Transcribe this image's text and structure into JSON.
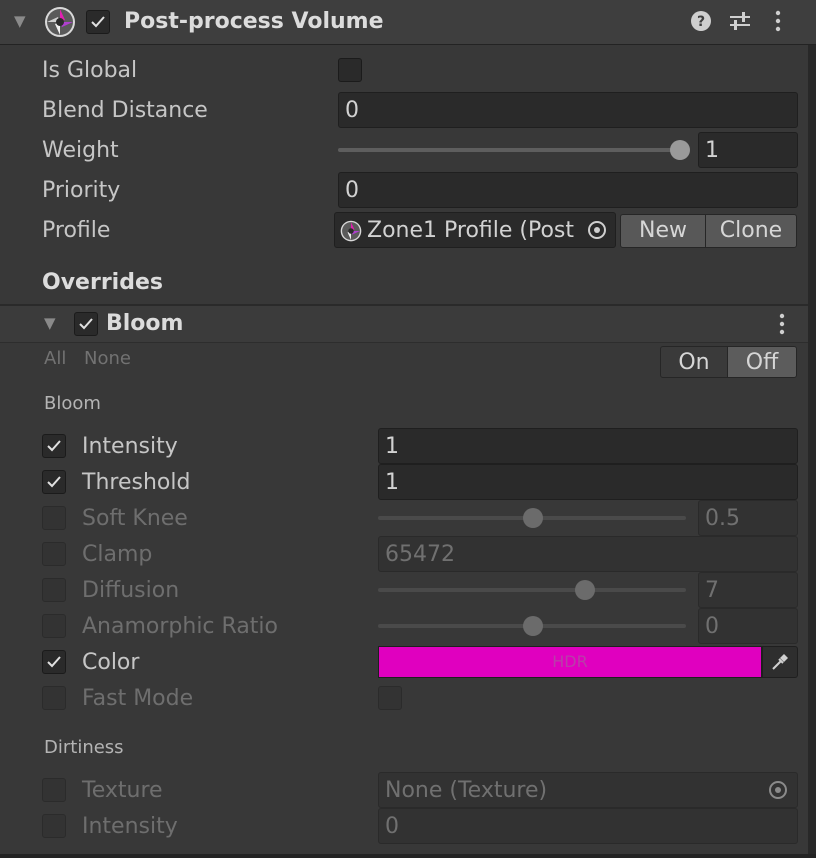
{
  "header": {
    "title": "Post-process Volume",
    "help_icon": "help-icon",
    "presets_icon": "presets-sliders-icon",
    "menu_icon": "kebab-menu-icon",
    "enabled": true
  },
  "volume": {
    "is_global": {
      "label": "Is Global",
      "checked": false
    },
    "blend_distance": {
      "label": "Blend Distance",
      "value": "0"
    },
    "weight": {
      "label": "Weight",
      "value": "1",
      "fraction": 1.0
    },
    "priority": {
      "label": "Priority",
      "value": "0"
    },
    "profile": {
      "label": "Profile",
      "value": "Zone1 Profile (Post",
      "new_label": "New",
      "clone_label": "Clone"
    }
  },
  "overrides": {
    "title": "Overrides",
    "bloom": {
      "title": "Bloom",
      "enabled": true,
      "all_label": "All",
      "none_label": "None",
      "on_label": "On",
      "off_label": "Off",
      "section_bloom": "Bloom",
      "section_dirtiness": "Dirtiness",
      "intensity": {
        "label": "Intensity",
        "value": "1",
        "checked": true
      },
      "threshold": {
        "label": "Threshold",
        "value": "1",
        "checked": true
      },
      "soft_knee": {
        "label": "Soft Knee",
        "value": "0.5",
        "fraction": 0.5,
        "checked": false
      },
      "clamp": {
        "label": "Clamp",
        "value": "65472",
        "checked": false
      },
      "diffusion": {
        "label": "Diffusion",
        "value": "7",
        "fraction": 0.667,
        "checked": false
      },
      "anamorphic_ratio": {
        "label": "Anamorphic Ratio",
        "value": "0",
        "fraction": 0.5,
        "checked": false
      },
      "color": {
        "label": "Color",
        "hdr_label": "HDR",
        "swatch": "#e000bf",
        "checked": true
      },
      "fast_mode": {
        "label": "Fast Mode",
        "checked": false
      },
      "dirt_texture": {
        "label": "Texture",
        "value": "None (Texture)",
        "checked": false
      },
      "dirt_intensity": {
        "label": "Intensity",
        "value": "0",
        "checked": false
      }
    }
  },
  "colors": {
    "panel_bg": "#383838",
    "accent_swatch": "#e000bf"
  }
}
